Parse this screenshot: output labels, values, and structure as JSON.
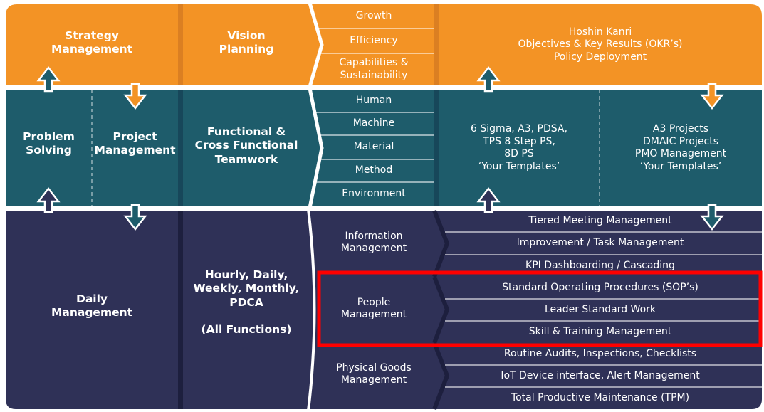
{
  "colors": {
    "strategy": "#F39325",
    "functional": "#1E5C6B",
    "daily": "#2F3157",
    "highlight": "#FF0000"
  },
  "strategy": {
    "title_lines": [
      "Strategy",
      "Management"
    ],
    "vision_lines": [
      "Vision",
      "Planning"
    ],
    "items": [
      "Growth",
      "Efficiency",
      "Capabilities & Sustainability"
    ],
    "items_cap_lines": [
      "Capabilities &",
      "Sustainability"
    ],
    "right_lines": [
      "Hoshin Kanri",
      "Objectives & Key Results (OKR’s)",
      "Policy Deployment"
    ]
  },
  "functional": {
    "problem_lines": [
      "Problem",
      "Solving"
    ],
    "project_lines": [
      "Project",
      "Management"
    ],
    "team_lines": [
      "Functional &",
      "Cross Functional",
      "Teamwork"
    ],
    "items": [
      "Human",
      "Machine",
      "Material",
      "Method",
      "Environment"
    ],
    "tools_lines": [
      "6 Sigma, A3, PDSA,",
      "TPS 8 Step PS,",
      "8D PS",
      "‘Your Templates’"
    ],
    "projects_lines": [
      "A3 Projects",
      "DMAIC Projects",
      "PMO Management",
      "‘Your Templates’"
    ]
  },
  "daily": {
    "title_lines": [
      "Daily",
      "Management"
    ],
    "cadence_lines": [
      "Hourly, Daily,",
      "Weekly, Monthly,",
      "PDCA",
      "",
      "(All Functions)"
    ],
    "groups": [
      {
        "label_lines": [
          "Information",
          "Management"
        ],
        "items": [
          "Tiered Meeting Management",
          "Improvement / Task Management",
          "KPI Dashboarding / Cascading"
        ]
      },
      {
        "label_lines": [
          "People",
          "Management"
        ],
        "items": [
          "Standard Operating Procedures (SOP’s)",
          "Leader Standard Work",
          "Skill & Training Management"
        ],
        "highlighted": true
      },
      {
        "label_lines": [
          "Physical Goods",
          "Management"
        ],
        "items": [
          "Routine Audits, Inspections, Checklists",
          "IoT Device interface, Alert Management",
          "Total Productive Maintenance (TPM)"
        ]
      }
    ]
  }
}
